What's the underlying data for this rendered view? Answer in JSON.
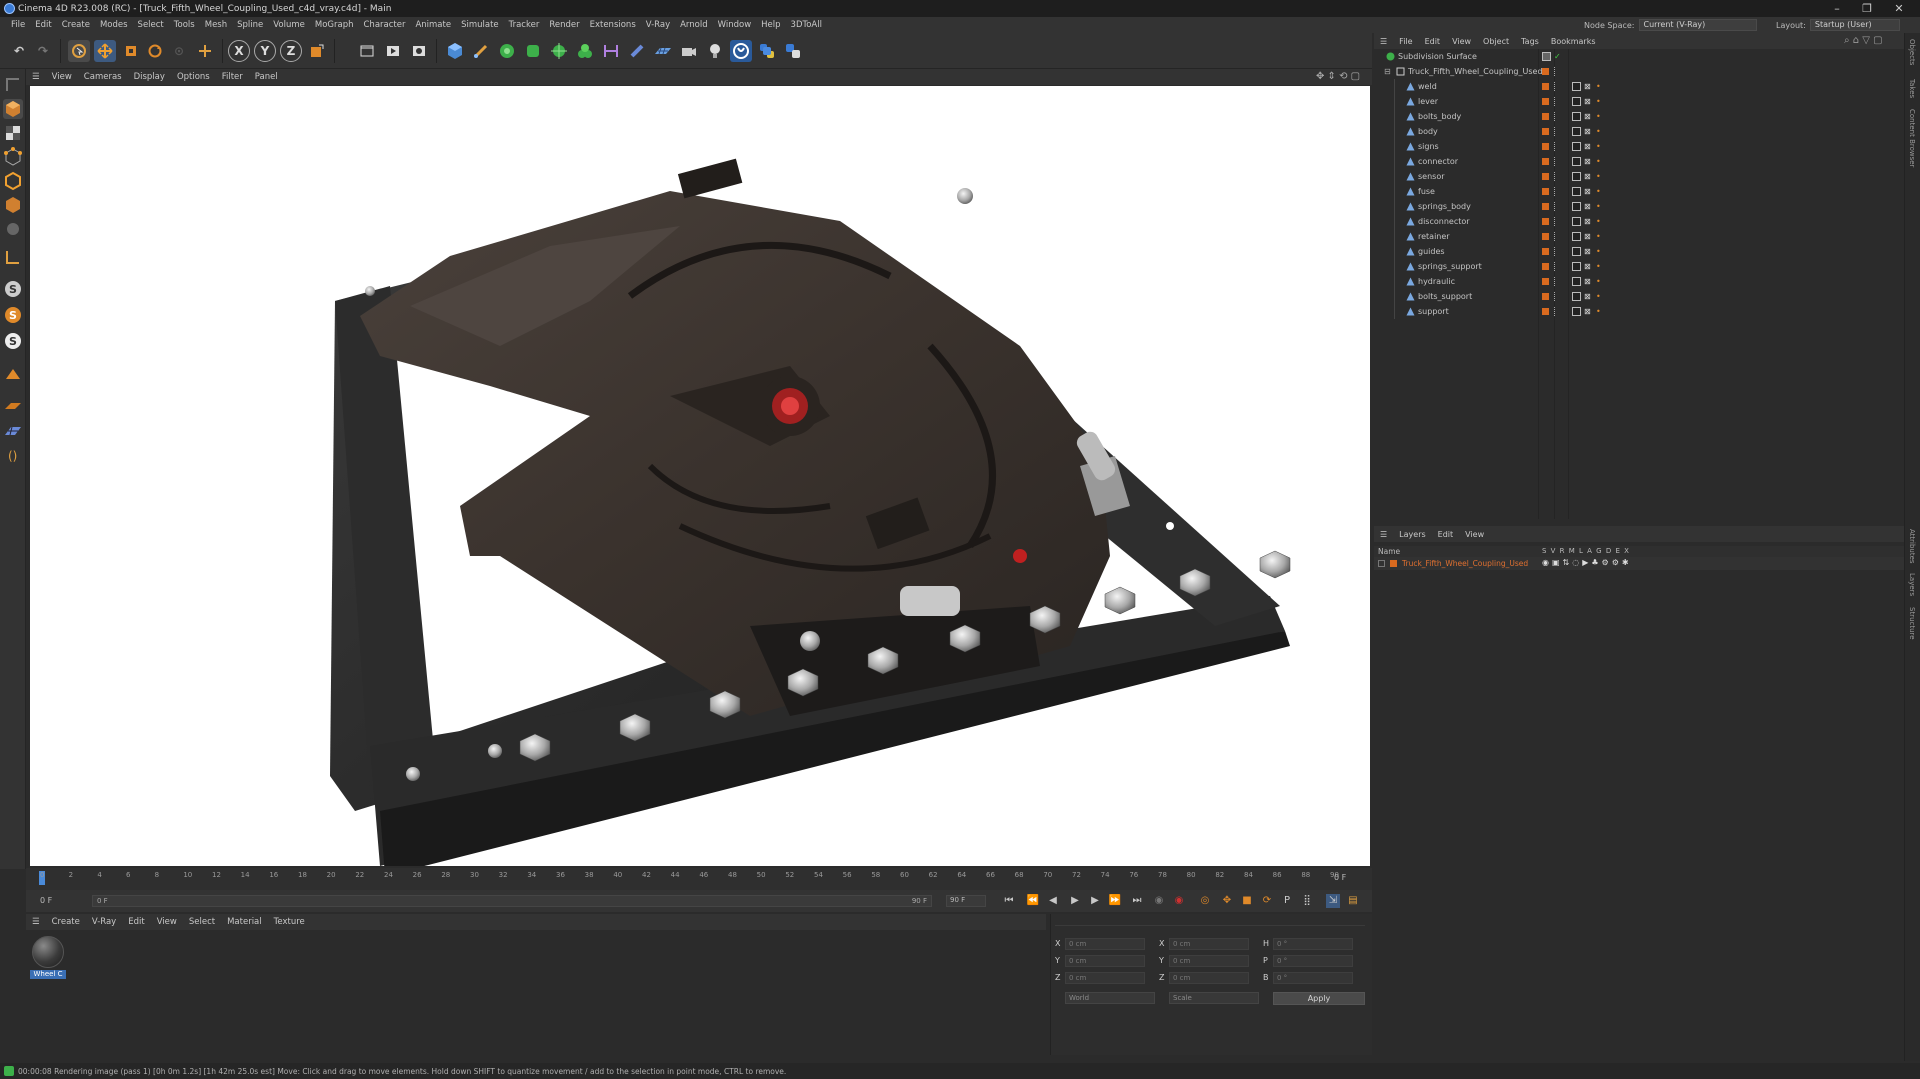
{
  "window": {
    "title": "Cinema 4D R23.008 (RC) - [Truck_Fifth_Wheel_Coupling_Used_c4d_vray.c4d] - Main",
    "controls": [
      "–",
      "❐",
      "✕"
    ]
  },
  "menubar": {
    "items": [
      "File",
      "Edit",
      "Create",
      "Modes",
      "Select",
      "Tools",
      "Mesh",
      "Spline",
      "Volume",
      "MoGraph",
      "Character",
      "Animate",
      "Simulate",
      "Tracker",
      "Render",
      "Extensions",
      "V-Ray",
      "Arnold",
      "Window",
      "Help",
      "3DToAll"
    ],
    "node_space_label": "Node Space:",
    "node_space_value": "Current (V-Ray)",
    "layout_label": "Layout:",
    "layout_value": "Startup (User)"
  },
  "toolbar": {
    "axis_x": "X",
    "axis_y": "Y",
    "axis_z": "Z"
  },
  "viewport": {
    "menu": [
      "View",
      "Cameras",
      "Display",
      "Options",
      "Filter",
      "Panel"
    ]
  },
  "timeline": {
    "ticks": [
      "0",
      "2",
      "4",
      "6",
      "8",
      "10",
      "12",
      "14",
      "16",
      "18",
      "20",
      "22",
      "24",
      "26",
      "28",
      "30",
      "32",
      "34",
      "36",
      "38",
      "40",
      "42",
      "44",
      "46",
      "48",
      "50",
      "52",
      "54",
      "56",
      "58",
      "60",
      "62",
      "64",
      "66",
      "68",
      "70",
      "72",
      "74",
      "76",
      "78",
      "80",
      "82",
      "84",
      "86",
      "88",
      "90"
    ],
    "current_frame": "0 F",
    "start_field": "0 F",
    "range_start": "0 F",
    "range_end": "90 F",
    "end_field": "90 F"
  },
  "material_manager": {
    "menu": [
      "Create",
      "V-Ray",
      "Edit",
      "View",
      "Select",
      "Material",
      "Texture"
    ],
    "material_name": "Wheel C"
  },
  "coordinates": {
    "rows": [
      {
        "axis": "X",
        "pos": "0 cm",
        "axis2": "X",
        "size": "0 cm",
        "axis3": "H",
        "rot": "0 °"
      },
      {
        "axis": "Y",
        "pos": "0 cm",
        "axis2": "Y",
        "size": "0 cm",
        "axis3": "P",
        "rot": "0 °"
      },
      {
        "axis": "Z",
        "pos": "0 cm",
        "axis2": "Z",
        "size": "0 cm",
        "axis3": "B",
        "rot": "0 °"
      }
    ],
    "mode_world": "World",
    "mode_scale": "Scale",
    "apply_label": "Apply"
  },
  "object_manager": {
    "menu": [
      "File",
      "Edit",
      "View",
      "Object",
      "Tags",
      "Bookmarks"
    ],
    "root": "Subdivision Surface",
    "group": "Truck_Fifth_Wheel_Coupling_Used",
    "children": [
      "weld",
      "lever",
      "bolts_body",
      "body",
      "signs",
      "connector",
      "sensor",
      "fuse",
      "springs_body",
      "disconnector",
      "retainer",
      "guides",
      "springs_support",
      "hydraulic",
      "bolts_support",
      "support"
    ]
  },
  "layer_manager": {
    "menu": [
      "Layers",
      "Edit",
      "View"
    ],
    "header_name": "Name",
    "header_flags": "S V R M L A G D E X",
    "layer_name": "Truck_Fifth_Wheel_Coupling_Used"
  },
  "right_tabs": [
    "Objects",
    "Takes",
    "Content Browser",
    "Attributes",
    "Layers",
    "Structure"
  ],
  "status": {
    "text": "00:00:08 Rendering image (pass 1) [0h  0m  1.2s] [1h 42m 25.0s est]      Move: Click and drag to move elements. Hold down SHIFT to quantize movement / add to the selection in point mode, CTRL to remove."
  },
  "colors": {
    "accent_orange": "#d96a1f",
    "selected_blue": "#3a6fb5",
    "viewport_bg": "#ffffff",
    "ui_bg": "#2b2b2b"
  }
}
